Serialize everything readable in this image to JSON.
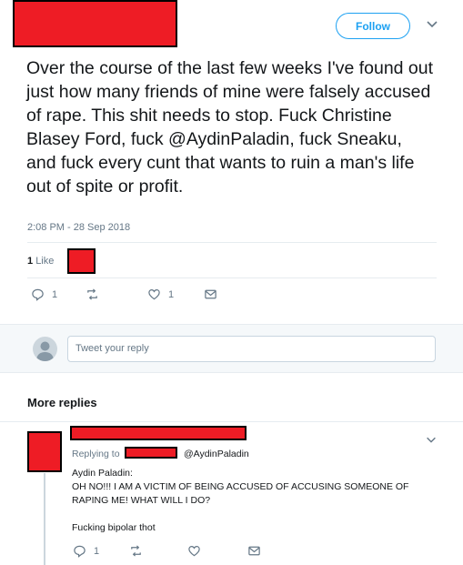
{
  "header": {
    "follow_label": "Follow"
  },
  "tweet": {
    "text": "Over the course of the last few weeks I've found out just how many friends of mine were falsely accused of rape. This shit needs to stop. Fuck Christine Blasey Ford, fuck @AydinPaladin, fuck Sneaku, and fuck every cunt that wants to ruin a man's life out of spite or profit.",
    "timestamp": "2:08 PM - 28 Sep 2018",
    "likes_count": "1",
    "likes_label": "Like",
    "actions": {
      "reply_count": "1",
      "like_count": "1"
    }
  },
  "reply_box": {
    "placeholder": "Tweet your reply"
  },
  "more_replies_label": "More replies",
  "reply": {
    "replying_prefix": "Replying to",
    "replying_handle": "@AydinPaladin",
    "line1": "Aydin Paladin:",
    "line2": "OH NO!!! I AM A VICTIM OF BEING ACCUSED OF ACCUSING SOMEONE OF",
    "line3": "RAPING ME! WHAT WILL I DO?",
    "line4": "Fucking bipolar thot",
    "reply_count": "1"
  },
  "colors": {
    "accent": "#1da1f2",
    "redaction": "#ee1c25",
    "muted_text": "#657786"
  },
  "icons": [
    "chevron-down-icon",
    "reply-icon",
    "retweet-icon",
    "heart-icon",
    "dm-icon",
    "default-avatar-icon"
  ]
}
